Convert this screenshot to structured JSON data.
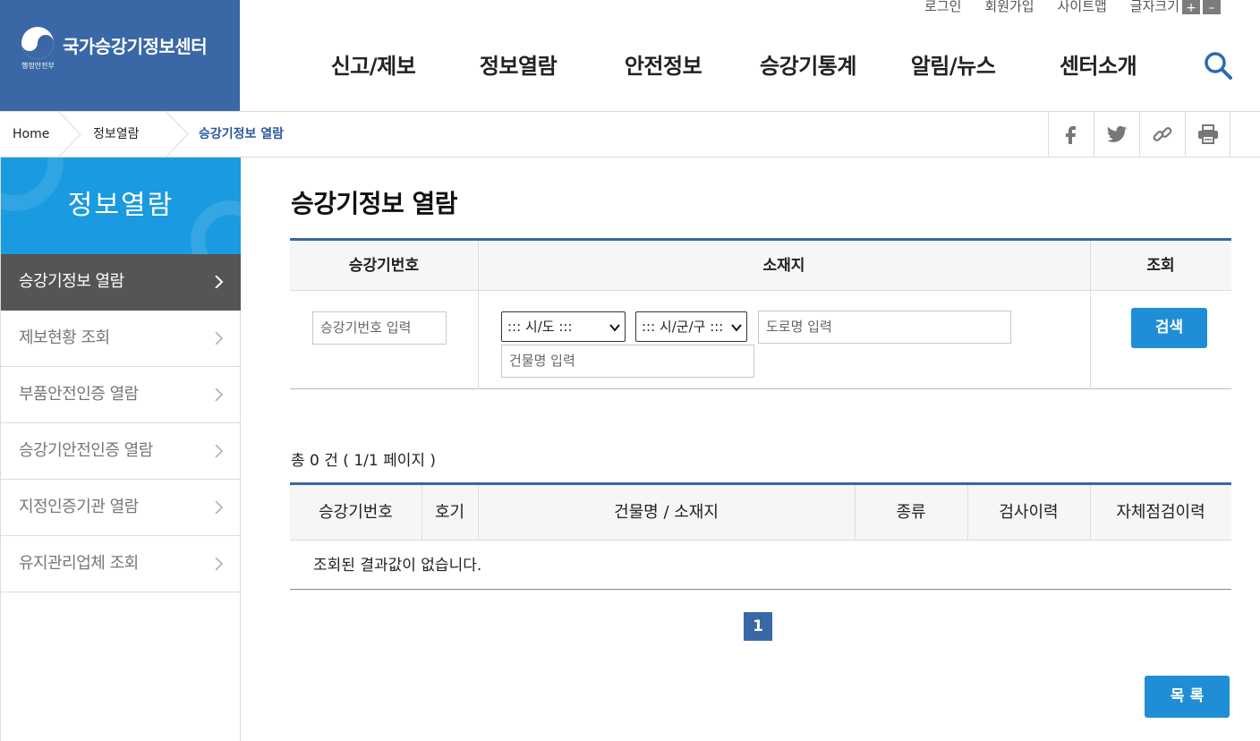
{
  "header": {
    "logo_title": "국가승강기정보센터",
    "logo_sub": "행정안전부",
    "util": {
      "login": "로그인",
      "join": "회원가입",
      "sitemap": "사이트맵",
      "font_size": "글자크기",
      "plus": "+",
      "minus": "–"
    },
    "gnb": [
      "신고/제보",
      "정보열람",
      "안전정보",
      "승강기통계",
      "알림/뉴스",
      "센터소개"
    ]
  },
  "breadcrumb": {
    "home": "Home",
    "level1": "정보열람",
    "level2": "승강기정보 열람"
  },
  "sidebar": {
    "title": "정보열람",
    "items": [
      {
        "label": "승강기정보 열람"
      },
      {
        "label": "제보현황 조회"
      },
      {
        "label": "부품안전인증 열람"
      },
      {
        "label": "승강기안전인증 열람"
      },
      {
        "label": "지정인증기관 열람"
      },
      {
        "label": "유지관리업체 조회"
      }
    ]
  },
  "main": {
    "title": "승강기정보 열람",
    "search": {
      "col_number": "승강기번호",
      "col_location": "소재지",
      "col_query": "조회",
      "number_placeholder": "승강기번호 입력",
      "sido_selected": "::: 시/도 :::",
      "sigungu_selected": "::: 시/군/구 :::",
      "road_placeholder": "도로명 입력",
      "building_placeholder": "건물명 입력",
      "search_button": "검색"
    },
    "total": "총 0 건 ( 1/1 페이지 )",
    "results": {
      "columns": [
        "승강기번호",
        "호기",
        "건물명 / 소재지",
        "종류",
        "검사이력",
        "자체점검이력"
      ],
      "empty": "조회된 결과값이 없습니다."
    },
    "page": "1",
    "list_button": "목 록"
  },
  "colors": {
    "brand": "#3a67a6",
    "sidebar_head": "#1a9ae0",
    "button": "#1f8ed6",
    "active_menu": "#555555"
  }
}
